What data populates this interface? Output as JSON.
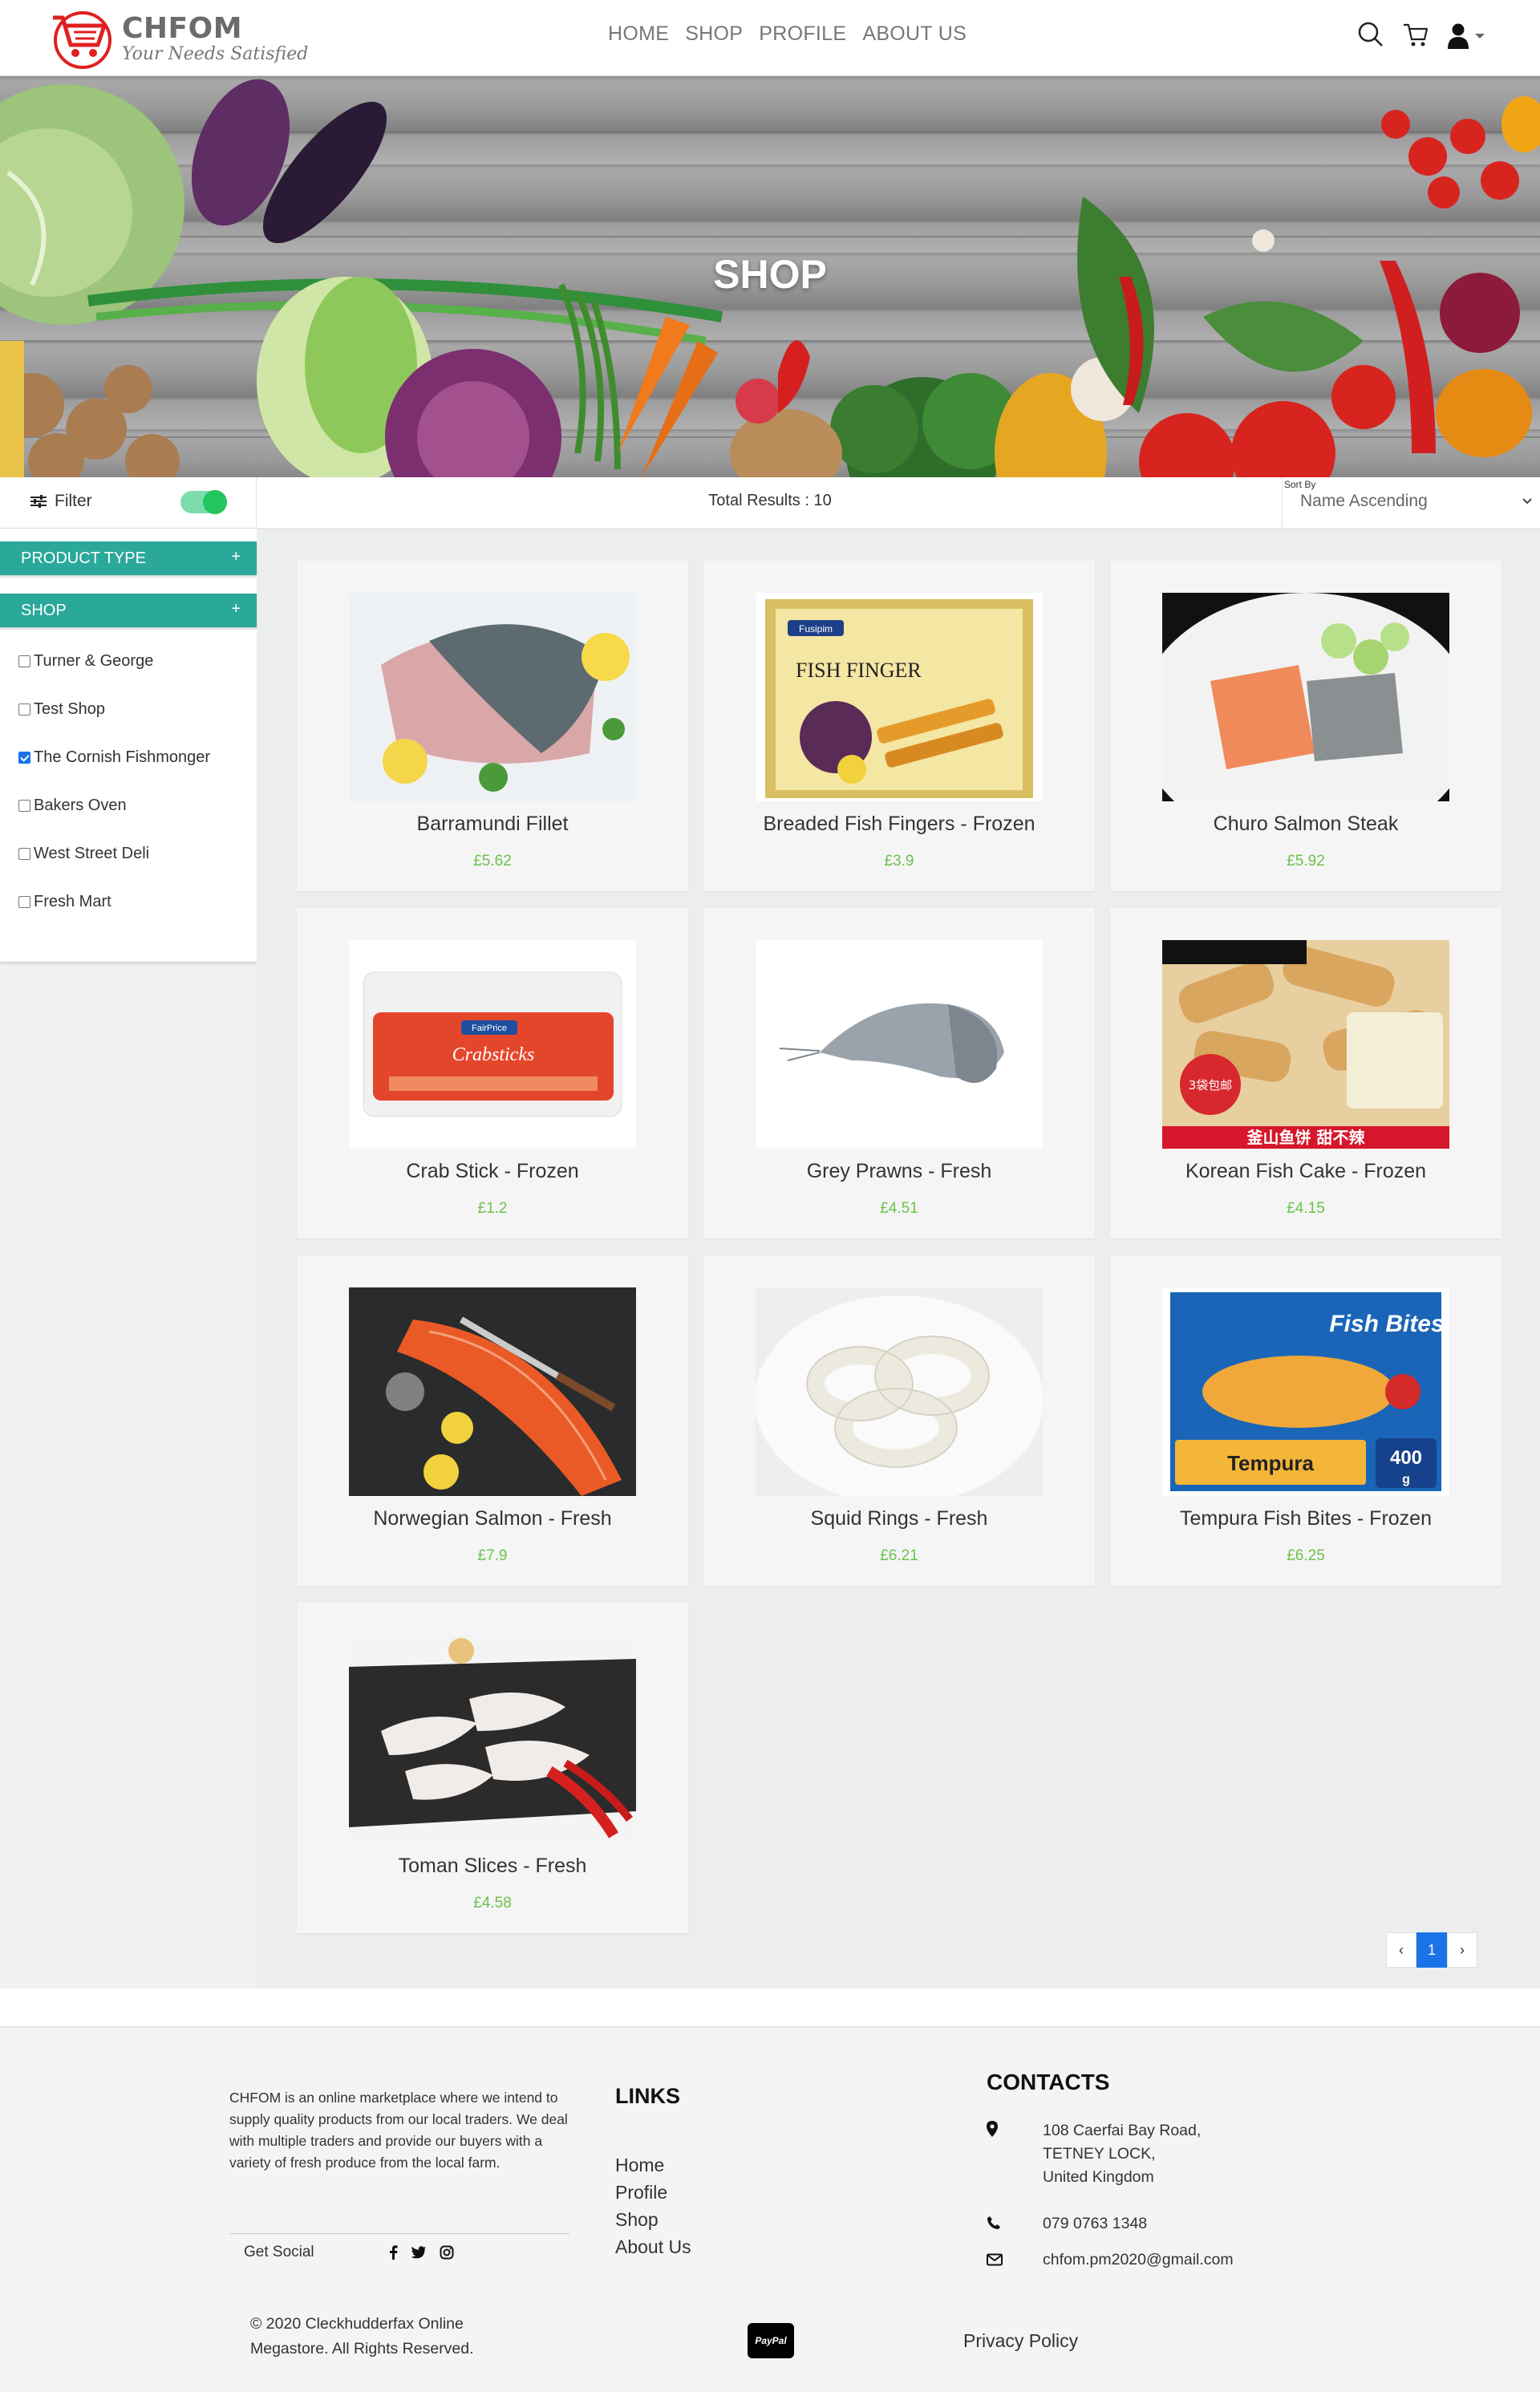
{
  "brand": {
    "name": "CHFOM",
    "tagline": "Your Needs Satisfied"
  },
  "nav": [
    "HOME",
    "SHOP",
    "PROFILE",
    "ABOUT US"
  ],
  "hero": {
    "title": "SHOP"
  },
  "toolbar": {
    "filter_label": "Filter",
    "filter_toggle_on": true,
    "total_results": "Total Results : 10",
    "sort_label": "Sort By",
    "sort_value": "Name Ascending"
  },
  "sidebar": {
    "product_type_label": "PRODUCT TYPE",
    "shop_label": "SHOP",
    "shops": [
      {
        "label": "Turner & George",
        "checked": false
      },
      {
        "label": "Test Shop",
        "checked": false
      },
      {
        "label": "The Cornish Fishmonger",
        "checked": true
      },
      {
        "label": "Bakers Oven",
        "checked": false
      },
      {
        "label": "West Street Deli",
        "checked": false
      },
      {
        "label": "Fresh Mart",
        "checked": false
      }
    ]
  },
  "products": [
    {
      "name": "Barramundi Fillet",
      "price": "£5.62"
    },
    {
      "name": "Breaded Fish Fingers - Frozen",
      "price": "£3.9"
    },
    {
      "name": "Churo Salmon Steak",
      "price": "£5.92"
    },
    {
      "name": "Crab Stick - Frozen",
      "price": "£1.2"
    },
    {
      "name": "Grey Prawns - Fresh",
      "price": "£4.51"
    },
    {
      "name": "Korean Fish Cake - Frozen",
      "price": "£4.15"
    },
    {
      "name": "Norwegian Salmon - Fresh",
      "price": "£7.9"
    },
    {
      "name": "Squid Rings - Fresh",
      "price": "£6.21"
    },
    {
      "name": "Tempura Fish Bites - Frozen",
      "price": "£6.25"
    },
    {
      "name": "Toman Slices - Fresh",
      "price": "£4.58"
    }
  ],
  "product_images": {
    "fish_fingers_brand": "Fusipim",
    "fish_fingers_title": "FISH FINGER",
    "crabsticks_brand": "FairPrice",
    "crabsticks_title": "Crabsticks",
    "fishcake_badge": "3袋包邮",
    "fishcake_banner": "釜山鱼饼 甜不辣",
    "tempura_title": "Fish Bites",
    "tempura_label": "Tempura",
    "tempura_weight": "400",
    "tempura_unit": "g"
  },
  "pagination": {
    "prev": "‹",
    "current": "1",
    "next": "›"
  },
  "footer": {
    "about": "CHFOM is an online marketplace where we intend to supply quality products from our local traders. We deal with multiple traders and provide our buyers with a variety of fresh produce from the local farm.",
    "social_label": "Get Social",
    "links_heading": "LINKS",
    "links": [
      "Home",
      "Profile",
      "Shop",
      "About Us"
    ],
    "contacts_heading": "CONTACTS",
    "address_lines": [
      "108 Caerfai Bay Road,",
      "TETNEY LOCK,",
      "United Kingdom"
    ],
    "phone": "079 0763 1348",
    "email": "chfom.pm2020@gmail.com",
    "copyright_lines": [
      "© 2020 Cleckhudderfax Online",
      "Megastore. All Rights Reserved."
    ],
    "paypal": "PayPal",
    "privacy": "Privacy Policy"
  },
  "colors": {
    "accent": "#2aa89a",
    "price": "#6cc24a",
    "toggle": "#22c55e",
    "active_page": "#1a73e8",
    "brand_red": "#e02020"
  },
  "icons": [
    "cart-logo-icon",
    "search-icon",
    "cart-icon",
    "user-icon",
    "caret-down-icon",
    "filter-sliders-icon",
    "plus-icon",
    "map-marker-icon",
    "phone-icon",
    "envelope-icon",
    "facebook-icon",
    "twitter-icon",
    "instagram-icon"
  ]
}
